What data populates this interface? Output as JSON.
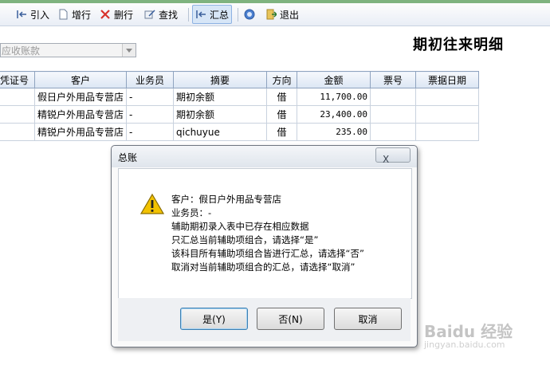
{
  "toolbar": {
    "items": [
      {
        "label": "引入",
        "icon": "import-icon"
      },
      {
        "label": "增行",
        "icon": "add-row-icon"
      },
      {
        "label": "删行",
        "icon": "delete-row-icon"
      },
      {
        "label": "查找",
        "icon": "find-icon"
      },
      {
        "label": "汇总",
        "icon": "summary-icon",
        "active": true
      },
      {
        "label": "",
        "icon": "help-icon"
      },
      {
        "label": "退出",
        "icon": "exit-icon"
      }
    ]
  },
  "account_select": {
    "value": "应收账款"
  },
  "page_title": "期初往来明细",
  "table": {
    "columns": [
      "凭证号",
      "客户",
      "业务员",
      "摘要",
      "方向",
      "金额",
      "票号",
      "票据日期"
    ],
    "rows": [
      {
        "voucher": "",
        "customer": "假日户外用品专营店",
        "salesperson": "-",
        "summary": "期初余额",
        "direction": "借",
        "amount": "11,700.00",
        "ticket": "",
        "ticket_date": ""
      },
      {
        "voucher": "",
        "customer": "精锐户外用品专营店",
        "salesperson": "-",
        "summary": "期初余额",
        "direction": "借",
        "amount": "23,400.00",
        "ticket": "",
        "ticket_date": ""
      },
      {
        "voucher": "",
        "customer": "精锐户外用品专营店",
        "salesperson": "-",
        "summary": "qichuyue",
        "direction": "借",
        "amount": "235.00",
        "ticket": "",
        "ticket_date": ""
      }
    ]
  },
  "dialog": {
    "title": "总账",
    "close_label": "X",
    "lines": [
      "客户：假日户外用品专营店",
      "业务员：-",
      "辅助期初录入表中已存在相应数据",
      "只汇总当前辅助项组合，请选择“是”",
      "该科目所有辅助项组合皆进行汇总，请选择“否”",
      "取消对当前辅助项组合的汇总，请选择“取消”"
    ],
    "buttons": {
      "yes": "是(Y)",
      "no": "否(N)",
      "cancel": "取消"
    }
  },
  "watermark": {
    "main": "Baidu 经验",
    "sub": "jingyan.baidu.com"
  },
  "colors": {
    "accent": "#3c7fb1",
    "header": "#dce6f4",
    "warning": "#f2c200"
  }
}
